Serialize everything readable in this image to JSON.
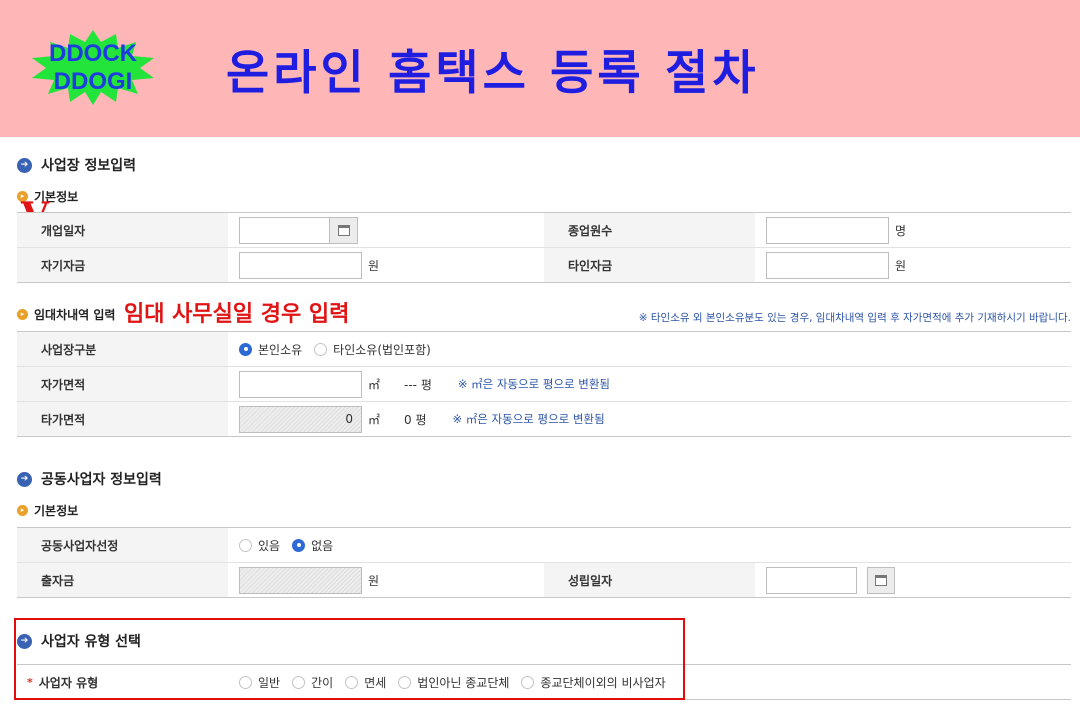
{
  "banner": {
    "logo_line1": "DDOCK",
    "logo_line2": "DDOGI",
    "title": "온라인 홈택스 등록 절차",
    "bg_color": "#feb6b7",
    "title_color": "#1f1de0"
  },
  "annotations": {
    "checkmark": "V",
    "lease_note": "임대 사무실일 경우 입력"
  },
  "business_info": {
    "title": "사업장 정보입력",
    "basic_title": "기본정보",
    "rows": {
      "open_date_label": "개업일자",
      "open_date_value": "",
      "employees_label": "종업원수",
      "employees_value": "",
      "employees_unit": "명",
      "own_capital_label": "자기자금",
      "own_capital_value": "",
      "own_capital_unit": "원",
      "other_capital_label": "타인자금",
      "other_capital_value": "",
      "other_capital_unit": "원"
    }
  },
  "lease": {
    "title": "임대차내역 입력",
    "notice": "※ 타인소유 외 본인소유분도 있는 경우, 임대차내역 입력 후 자가면적에 추가 기재하시기 바랍니다.",
    "premises_type_label": "사업장구분",
    "premises_options": [
      {
        "label": "본인소유",
        "selected": true
      },
      {
        "label": "타인소유(법인포함)",
        "selected": false
      }
    ],
    "own_area_label": "자가면적",
    "own_area_value": "",
    "own_area_unit": "㎡",
    "own_area_pyeong": "--- 평",
    "own_area_note": "※ ㎡은 자동으로 평으로 변환됨",
    "other_area_label": "타가면적",
    "other_area_value": "0",
    "other_area_unit": "㎡",
    "other_area_pyeong": "0 평",
    "other_area_note": "※ ㎡은 자동으로 평으로 변환됨"
  },
  "joint": {
    "title": "공동사업자 정보입력",
    "basic_title": "기본정보",
    "select_label": "공동사업자선정",
    "select_options": [
      {
        "label": "있음",
        "selected": false
      },
      {
        "label": "없음",
        "selected": true
      }
    ],
    "investment_label": "출자금",
    "investment_value": "",
    "investment_unit": "원",
    "established_label": "성립일자",
    "established_value": ""
  },
  "biz_type": {
    "title": "사업자 유형 선택",
    "required_mark": "*",
    "label": "사업자 유형",
    "options": [
      {
        "label": "일반",
        "selected": false
      },
      {
        "label": "간이",
        "selected": false
      },
      {
        "label": "면세",
        "selected": false
      },
      {
        "label": "법인아닌 종교단체",
        "selected": false
      },
      {
        "label": "종교단체이외의 비사업자",
        "selected": false
      }
    ],
    "highlight_color": "#e10d0d"
  }
}
